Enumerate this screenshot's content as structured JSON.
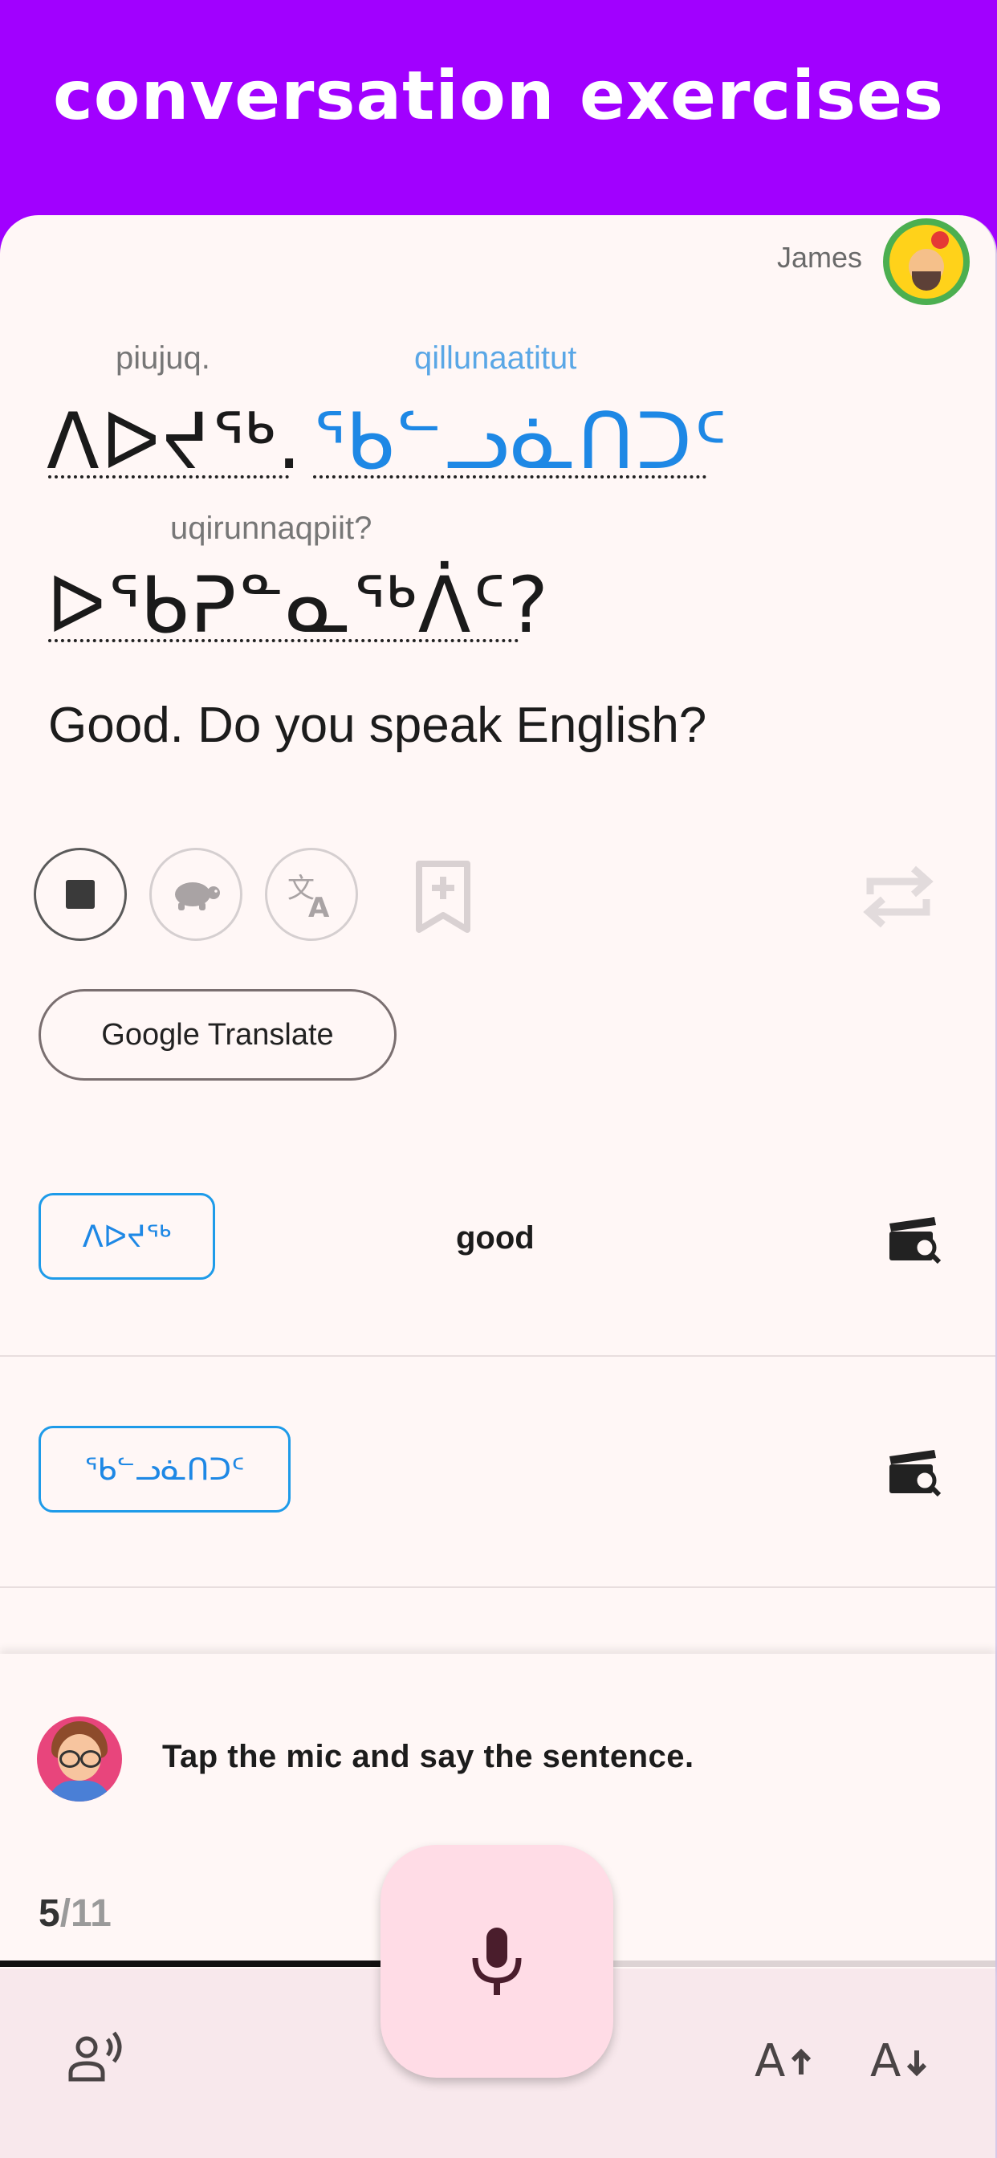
{
  "header": {
    "title": "conversation exercises"
  },
  "user": {
    "name": "James"
  },
  "sentence": {
    "line1": [
      {
        "roman": "piujuq.",
        "syllabics": "ᐱᐅᔪᖅ."
      },
      {
        "roman": "qillunaatitut",
        "syllabics": "ᖃᓪᓗᓈᑎᑐᑦ"
      }
    ],
    "line2": [
      {
        "roman": "uqirunnaqpiit?",
        "syllabics": "ᐅᖃᕈᓐᓇᖅᐲᑦ?"
      }
    ],
    "translation": "Good. Do you speak English?"
  },
  "controls": {
    "stop": "stop-icon",
    "slow": "turtle-icon",
    "translate": "translate-icon",
    "bookmark": "bookmark-add-icon",
    "repeat": "repeat-icon",
    "google_translate_label": "Google Translate"
  },
  "words": [
    {
      "syllabics": "ᐱᐅᔪᖅ",
      "english": "good"
    },
    {
      "syllabics": "ᖃᓪᓗᓈᑎᑐᑦ",
      "english": ""
    }
  ],
  "feedback": {
    "message": "Tap the mic and say the sentence."
  },
  "progress": {
    "current": "5",
    "total": "/11",
    "fraction": 0.4545
  },
  "bottom_bar": {
    "left_icon": "speaker-voice-icon",
    "mic_icon": "mic-icon",
    "font_increase_icon": "font-increase-icon",
    "font_decrease_icon": "font-decrease-icon"
  },
  "colors": {
    "header": "#a100ff",
    "accent_blue": "#1e88e5",
    "mic_button": "#ffdce6",
    "bottom_bar": "#f8e8ec"
  }
}
